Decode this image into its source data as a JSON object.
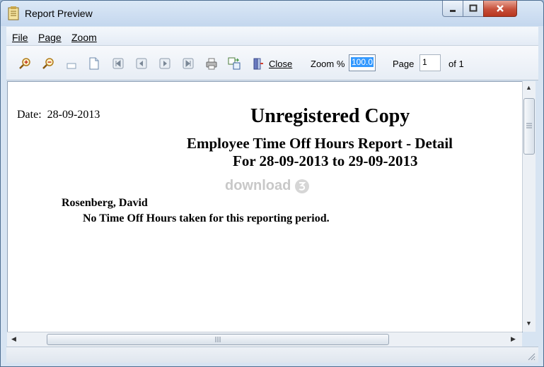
{
  "window": {
    "title": "Report Preview"
  },
  "menu": {
    "file": "File",
    "page": "Page",
    "zoom": "Zoom"
  },
  "toolbar": {
    "close_label": "Close",
    "zoom_label": "Zoom %",
    "zoom_value": "100.0",
    "page_label": "Page",
    "page_value": "1",
    "of_label": "of 1"
  },
  "report": {
    "date_label": "Date:",
    "date_value": "28-09-2013",
    "watermark": "Unregistered Copy",
    "title": "Employee Time Off Hours Report - Detail",
    "range": "For 28-09-2013 to 29-09-2013",
    "logo_text": "download",
    "employee_name": "Rosenberg, David",
    "employee_note": "No Time Off Hours taken for this reporting period."
  },
  "colors": {
    "accent": "#3399ff",
    "close_button": "#c7503a"
  }
}
